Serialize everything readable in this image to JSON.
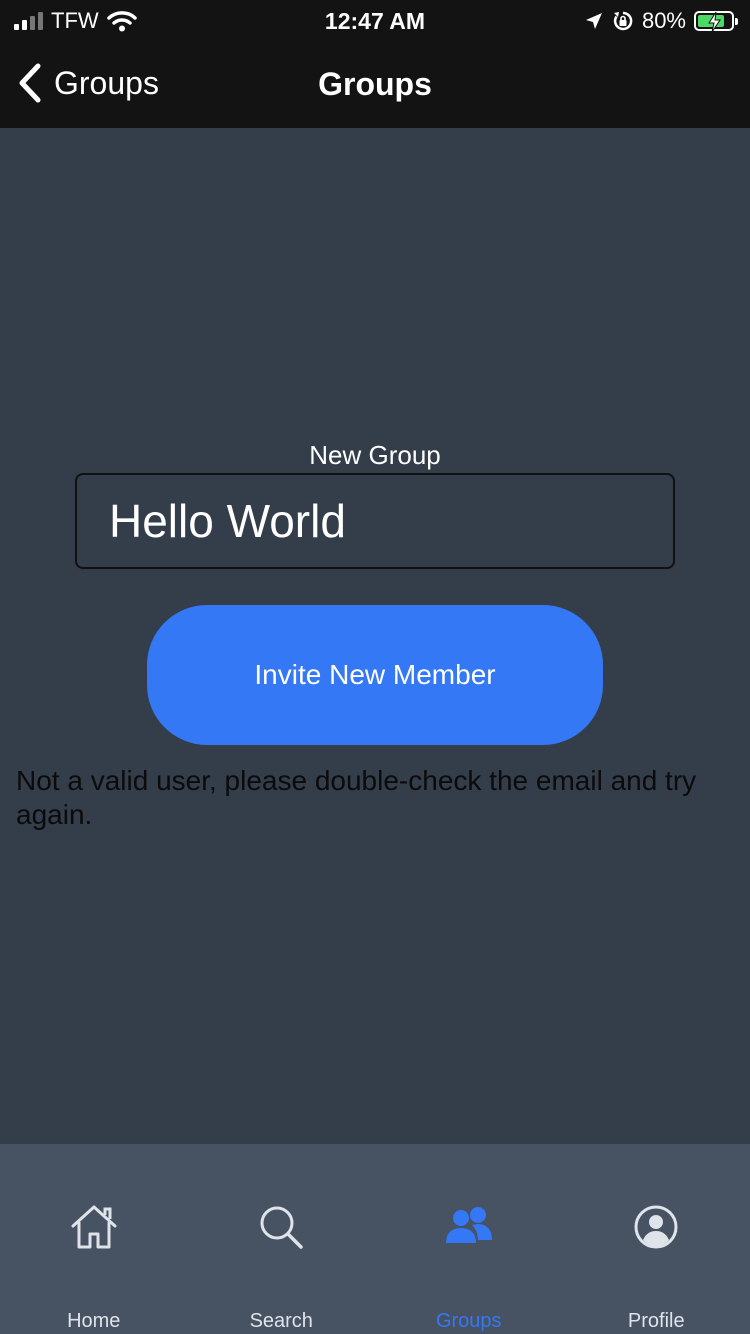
{
  "status_bar": {
    "carrier": "TFW",
    "time": "12:47 AM",
    "battery_percent": "80%",
    "battery_level": 0.8
  },
  "nav": {
    "back_label": "Groups",
    "title": "Groups"
  },
  "form": {
    "label": "New Group",
    "input_value": "Hello World",
    "button_label": "Invite New Member",
    "error_message": "Not a valid user, please double-check the email and try again."
  },
  "tabs": [
    {
      "label": "Home",
      "icon": "home-icon"
    },
    {
      "label": "Search",
      "icon": "search-icon"
    },
    {
      "label": "Groups",
      "icon": "groups-icon"
    },
    {
      "label": "Profile",
      "icon": "profile-icon"
    }
  ],
  "active_tab": "Groups",
  "colors": {
    "accent": "#3478f6",
    "background": "#343d4a",
    "bar": "#131313",
    "tab_bar": "#475263",
    "battery_fill": "#4cd964"
  }
}
